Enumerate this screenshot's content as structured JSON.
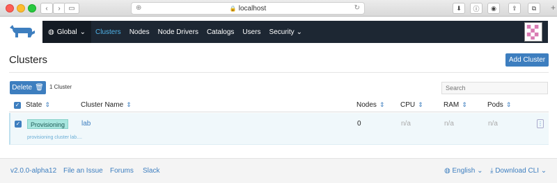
{
  "browser": {
    "url": "localhost",
    "lock_glyph": "🔒"
  },
  "nav": {
    "global": "Global",
    "items": [
      {
        "label": "Clusters",
        "active": true
      },
      {
        "label": "Nodes",
        "active": false
      },
      {
        "label": "Node Drivers",
        "active": false
      },
      {
        "label": "Catalogs",
        "active": false
      },
      {
        "label": "Users",
        "active": false
      },
      {
        "label": "Security",
        "active": false
      }
    ]
  },
  "page": {
    "title": "Clusters",
    "add_button": "Add Cluster",
    "delete_button": "Delete",
    "count": "1 Cluster",
    "search_placeholder": "Search"
  },
  "table": {
    "headers": {
      "state": "State",
      "name": "Cluster Name",
      "nodes": "Nodes",
      "cpu": "CPU",
      "ram": "RAM",
      "pods": "Pods"
    },
    "rows": [
      {
        "state": "Provisioning",
        "name": "lab",
        "nodes": "0",
        "cpu": "n/a",
        "ram": "n/a",
        "pods": "n/a",
        "message": "provisioning cluster lab...."
      }
    ]
  },
  "footer": {
    "version": "v2.0.0-alpha12",
    "file_issue": "File an Issue",
    "forums": "Forums",
    "slack": "Slack",
    "language": "English",
    "download": "Download CLI"
  },
  "colors": {
    "accent": "#3d7ebf",
    "nav_bg": "#1d2733",
    "badge": "#a8e6df"
  }
}
